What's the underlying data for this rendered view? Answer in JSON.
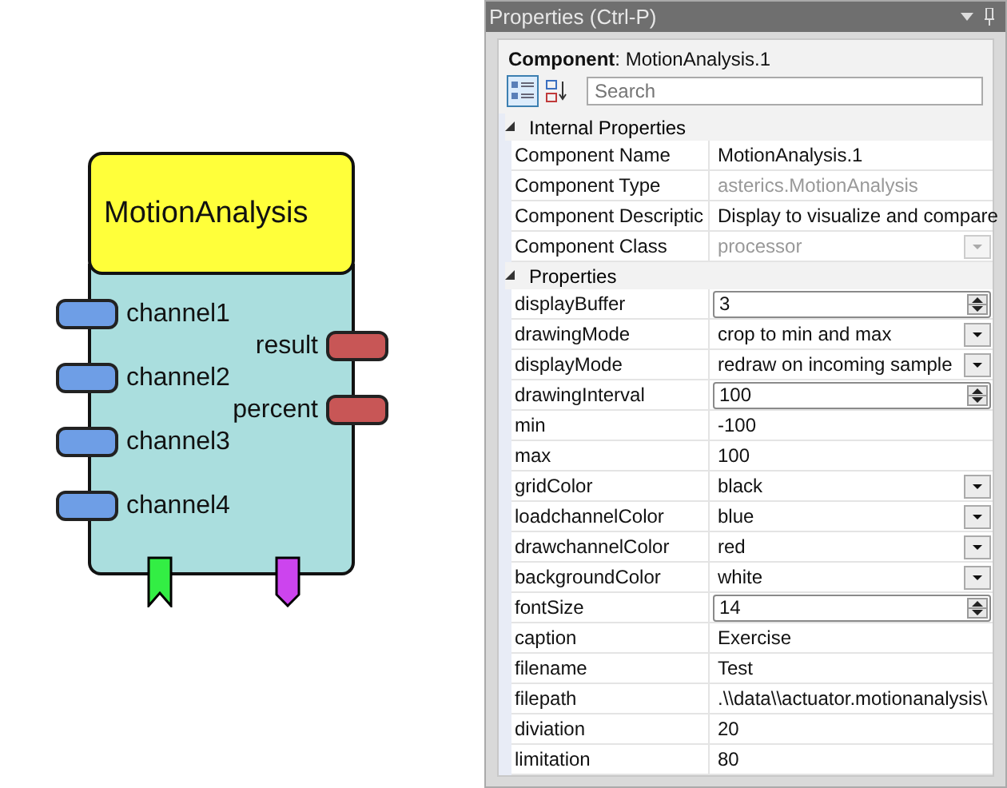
{
  "diagram": {
    "component": {
      "title": "MotionAnalysis",
      "inputs": [
        "channel1",
        "channel2",
        "channel3",
        "channel4"
      ],
      "outputs": [
        "result",
        "percent"
      ],
      "event_ports": [
        {
          "kind": "listener",
          "color": "#33ee44"
        },
        {
          "kind": "trigger",
          "color": "#cc44ee"
        }
      ]
    }
  },
  "properties_panel": {
    "title": "Properties (Ctrl-P)",
    "component_heading": "**Component**: MotionAnalysis.1",
    "toolbar": [
      {
        "kind": "categorized",
        "selected": true
      },
      {
        "kind": "alphabetical",
        "selected": false
      }
    ],
    "search": {
      "placeholder": "Search"
    },
    "categories": [
      {
        "name": "Internal Properties",
        "expanded": true,
        "rows": [
          {
            "name": "Component Name",
            "value": "MotionAnalysis.1",
            "kind": "text",
            "disabled": false
          },
          {
            "name": "Component Type",
            "value": "asterics.MotionAnalysis",
            "kind": "text",
            "disabled": true
          },
          {
            "name": "Component Descriptic",
            "value": "Display to visualize and compare",
            "kind": "text",
            "disabled": false
          },
          {
            "name": "Component Class",
            "value": "processor",
            "kind": "dropdown",
            "disabled": true
          }
        ]
      },
      {
        "name": "Properties",
        "expanded": true,
        "rows": [
          {
            "name": "displayBuffer",
            "value": "3",
            "kind": "spin",
            "disabled": false
          },
          {
            "name": "drawingMode",
            "value": "crop to min and max",
            "kind": "dropdown",
            "disabled": false
          },
          {
            "name": "displayMode",
            "value": "redraw on incoming sample",
            "kind": "dropdown",
            "disabled": false
          },
          {
            "name": "drawingInterval",
            "value": "100",
            "kind": "spin",
            "disabled": false
          },
          {
            "name": "min",
            "value": "-100",
            "kind": "text",
            "disabled": false
          },
          {
            "name": "max",
            "value": "100",
            "kind": "text",
            "disabled": false
          },
          {
            "name": "gridColor",
            "value": "black",
            "kind": "dropdown",
            "disabled": false
          },
          {
            "name": "loadchannelColor",
            "value": "blue",
            "kind": "dropdown",
            "disabled": false
          },
          {
            "name": "drawchannelColor",
            "value": "red",
            "kind": "dropdown",
            "disabled": false
          },
          {
            "name": "backgroundColor",
            "value": "white",
            "kind": "dropdown",
            "disabled": false
          },
          {
            "name": "fontSize",
            "value": "14",
            "kind": "spin",
            "disabled": false
          },
          {
            "name": "caption",
            "value": "Exercise",
            "kind": "text",
            "disabled": false
          },
          {
            "name": "filename",
            "value": "Test",
            "kind": "text",
            "disabled": false
          },
          {
            "name": "filepath",
            "value": ".\\\\data\\\\actuator.motionanalysis\\",
            "kind": "text",
            "disabled": false
          },
          {
            "name": "diviation",
            "value": "20",
            "kind": "text",
            "disabled": false
          },
          {
            "name": "limitation",
            "value": "80",
            "kind": "text",
            "disabled": false
          }
        ]
      }
    ]
  }
}
